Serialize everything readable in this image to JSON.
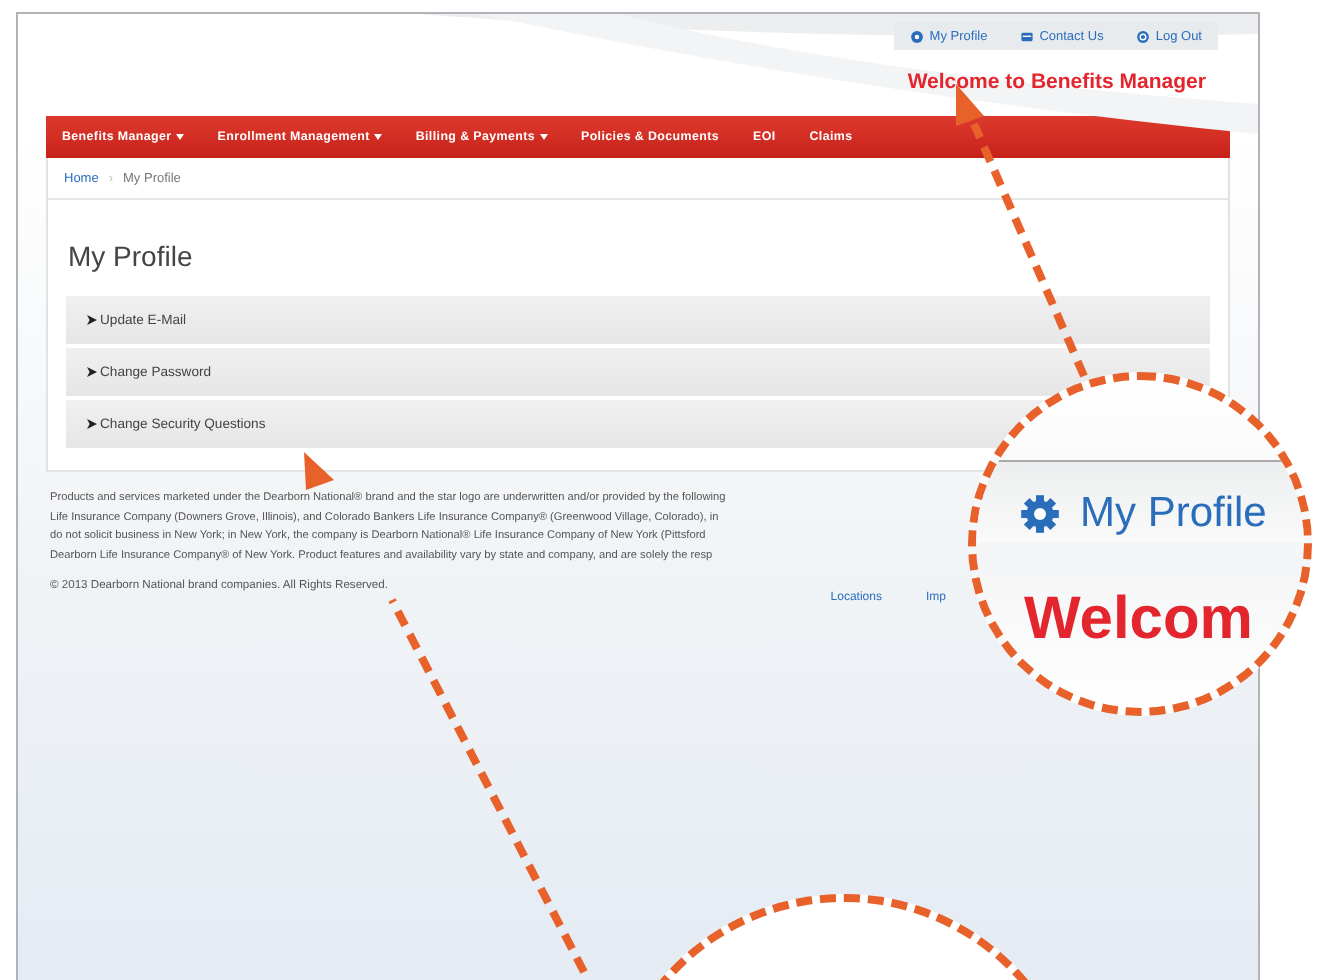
{
  "header": {
    "links": [
      {
        "label": "My Profile"
      },
      {
        "label": "Contact Us"
      },
      {
        "label": "Log Out"
      }
    ],
    "welcome": "Welcome to Benefits Manager"
  },
  "nav": [
    {
      "label": "Benefits Manager",
      "dropdown": true
    },
    {
      "label": "Enrollment Management",
      "dropdown": true
    },
    {
      "label": "Billing & Payments",
      "dropdown": true
    },
    {
      "label": "Policies & Documents",
      "dropdown": false
    },
    {
      "label": "EOI",
      "dropdown": false
    },
    {
      "label": "Claims",
      "dropdown": false
    }
  ],
  "breadcrumb": {
    "separator": "›",
    "items": [
      {
        "label": "Home",
        "link": true
      },
      {
        "label": "My Profile",
        "link": false
      }
    ]
  },
  "page_title": "My Profile",
  "sections": [
    {
      "label": "Update E-Mail",
      "expanded": false
    },
    {
      "label": "Change Password",
      "expanded": false
    },
    {
      "label": "Change Security Questions",
      "expanded": false
    }
  ],
  "footer": {
    "disclaimer_lines": [
      "Products and services marketed under the Dearborn National® brand and the star logo are underwritten and/or provided by the following",
      "Life Insurance Company (Downers Grove, Illinois), and Colorado Bankers Life Insurance Company® (Greenwood Village, Colorado), in",
      "do not solicit business in New York; in New York, the company is Dearborn National® Life Insurance Company of New York (Pittsford",
      "Dearborn Life Insurance Company® of New York. Product features and availability vary by state and company, and are solely the resp"
    ],
    "copyright": "© 2013 Dearborn National brand companies. All Rights Reserved.",
    "links": [
      "Locations",
      "Imp"
    ]
  },
  "magnifier": {
    "link_label": "My Profile",
    "welcome": "Welcom"
  }
}
